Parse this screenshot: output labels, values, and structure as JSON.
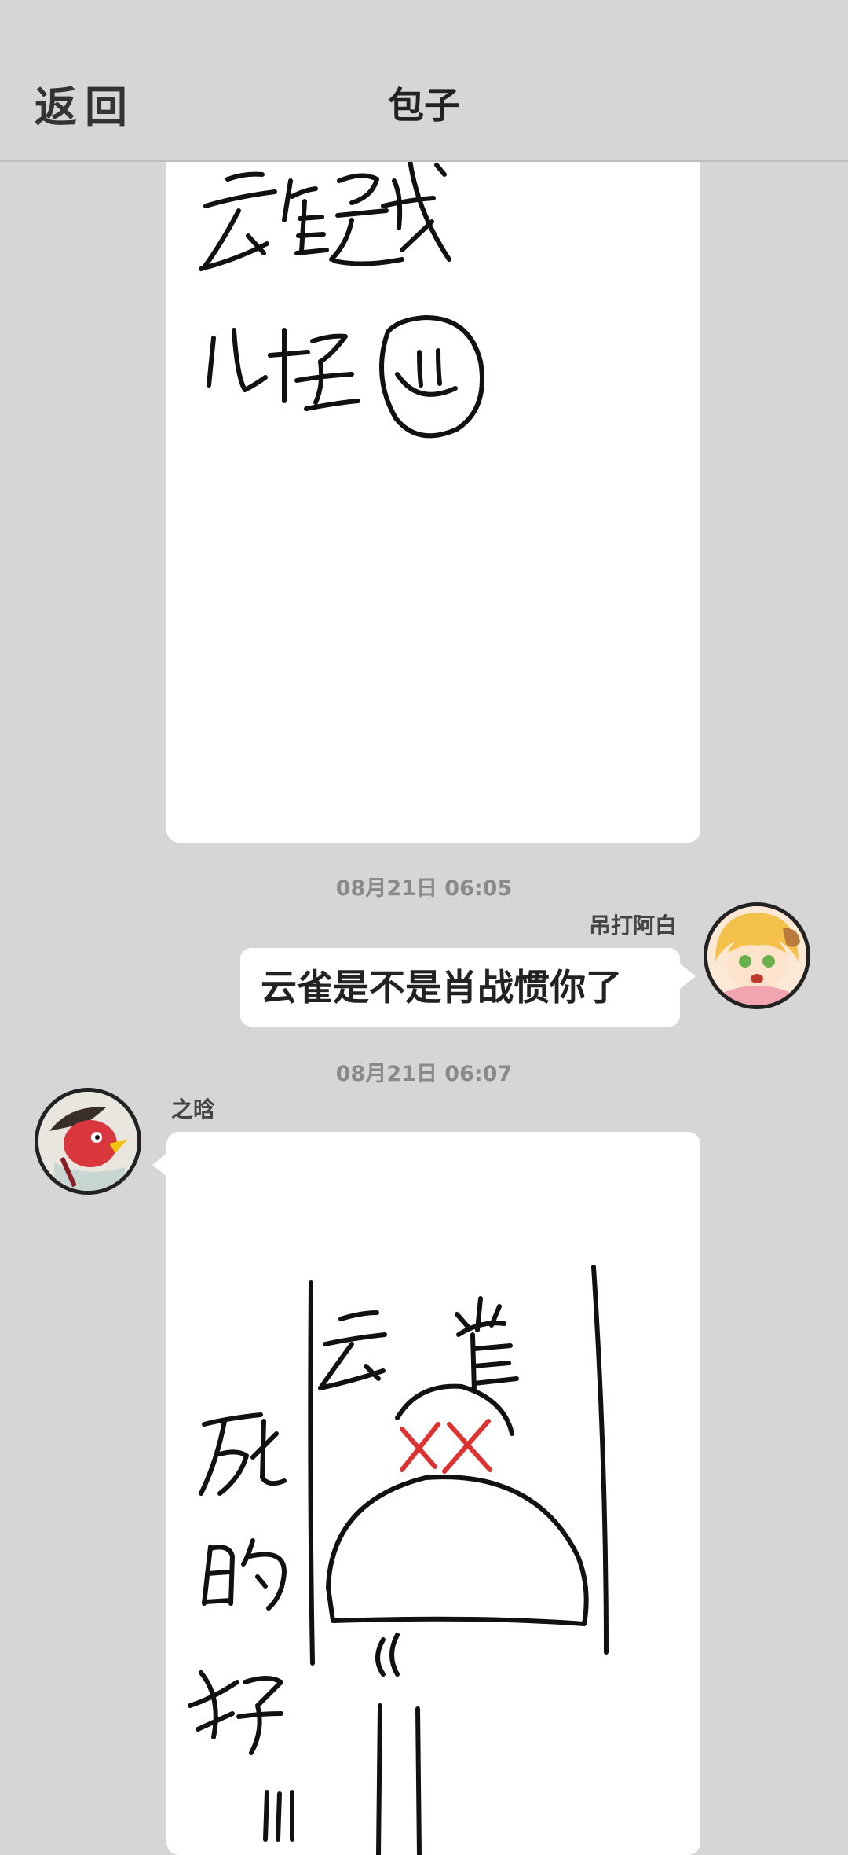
{
  "header": {
    "back_label": "返回",
    "title": "包子"
  },
  "messages": [
    {
      "type": "image",
      "sender": "之晗",
      "drawn_text": "云雀是我儿子"
    },
    {
      "time": "08月21日  06:05",
      "sender": "吊打阿白",
      "text": "云雀是不是肖战惯你了"
    },
    {
      "time": "08月21日  06:07",
      "sender": "之晗",
      "type": "image",
      "drawn_text": "云雀 死的好"
    }
  ],
  "icons": {
    "avatar_right": "anime-girl-avatar",
    "avatar_left": "red-bird-avatar"
  }
}
